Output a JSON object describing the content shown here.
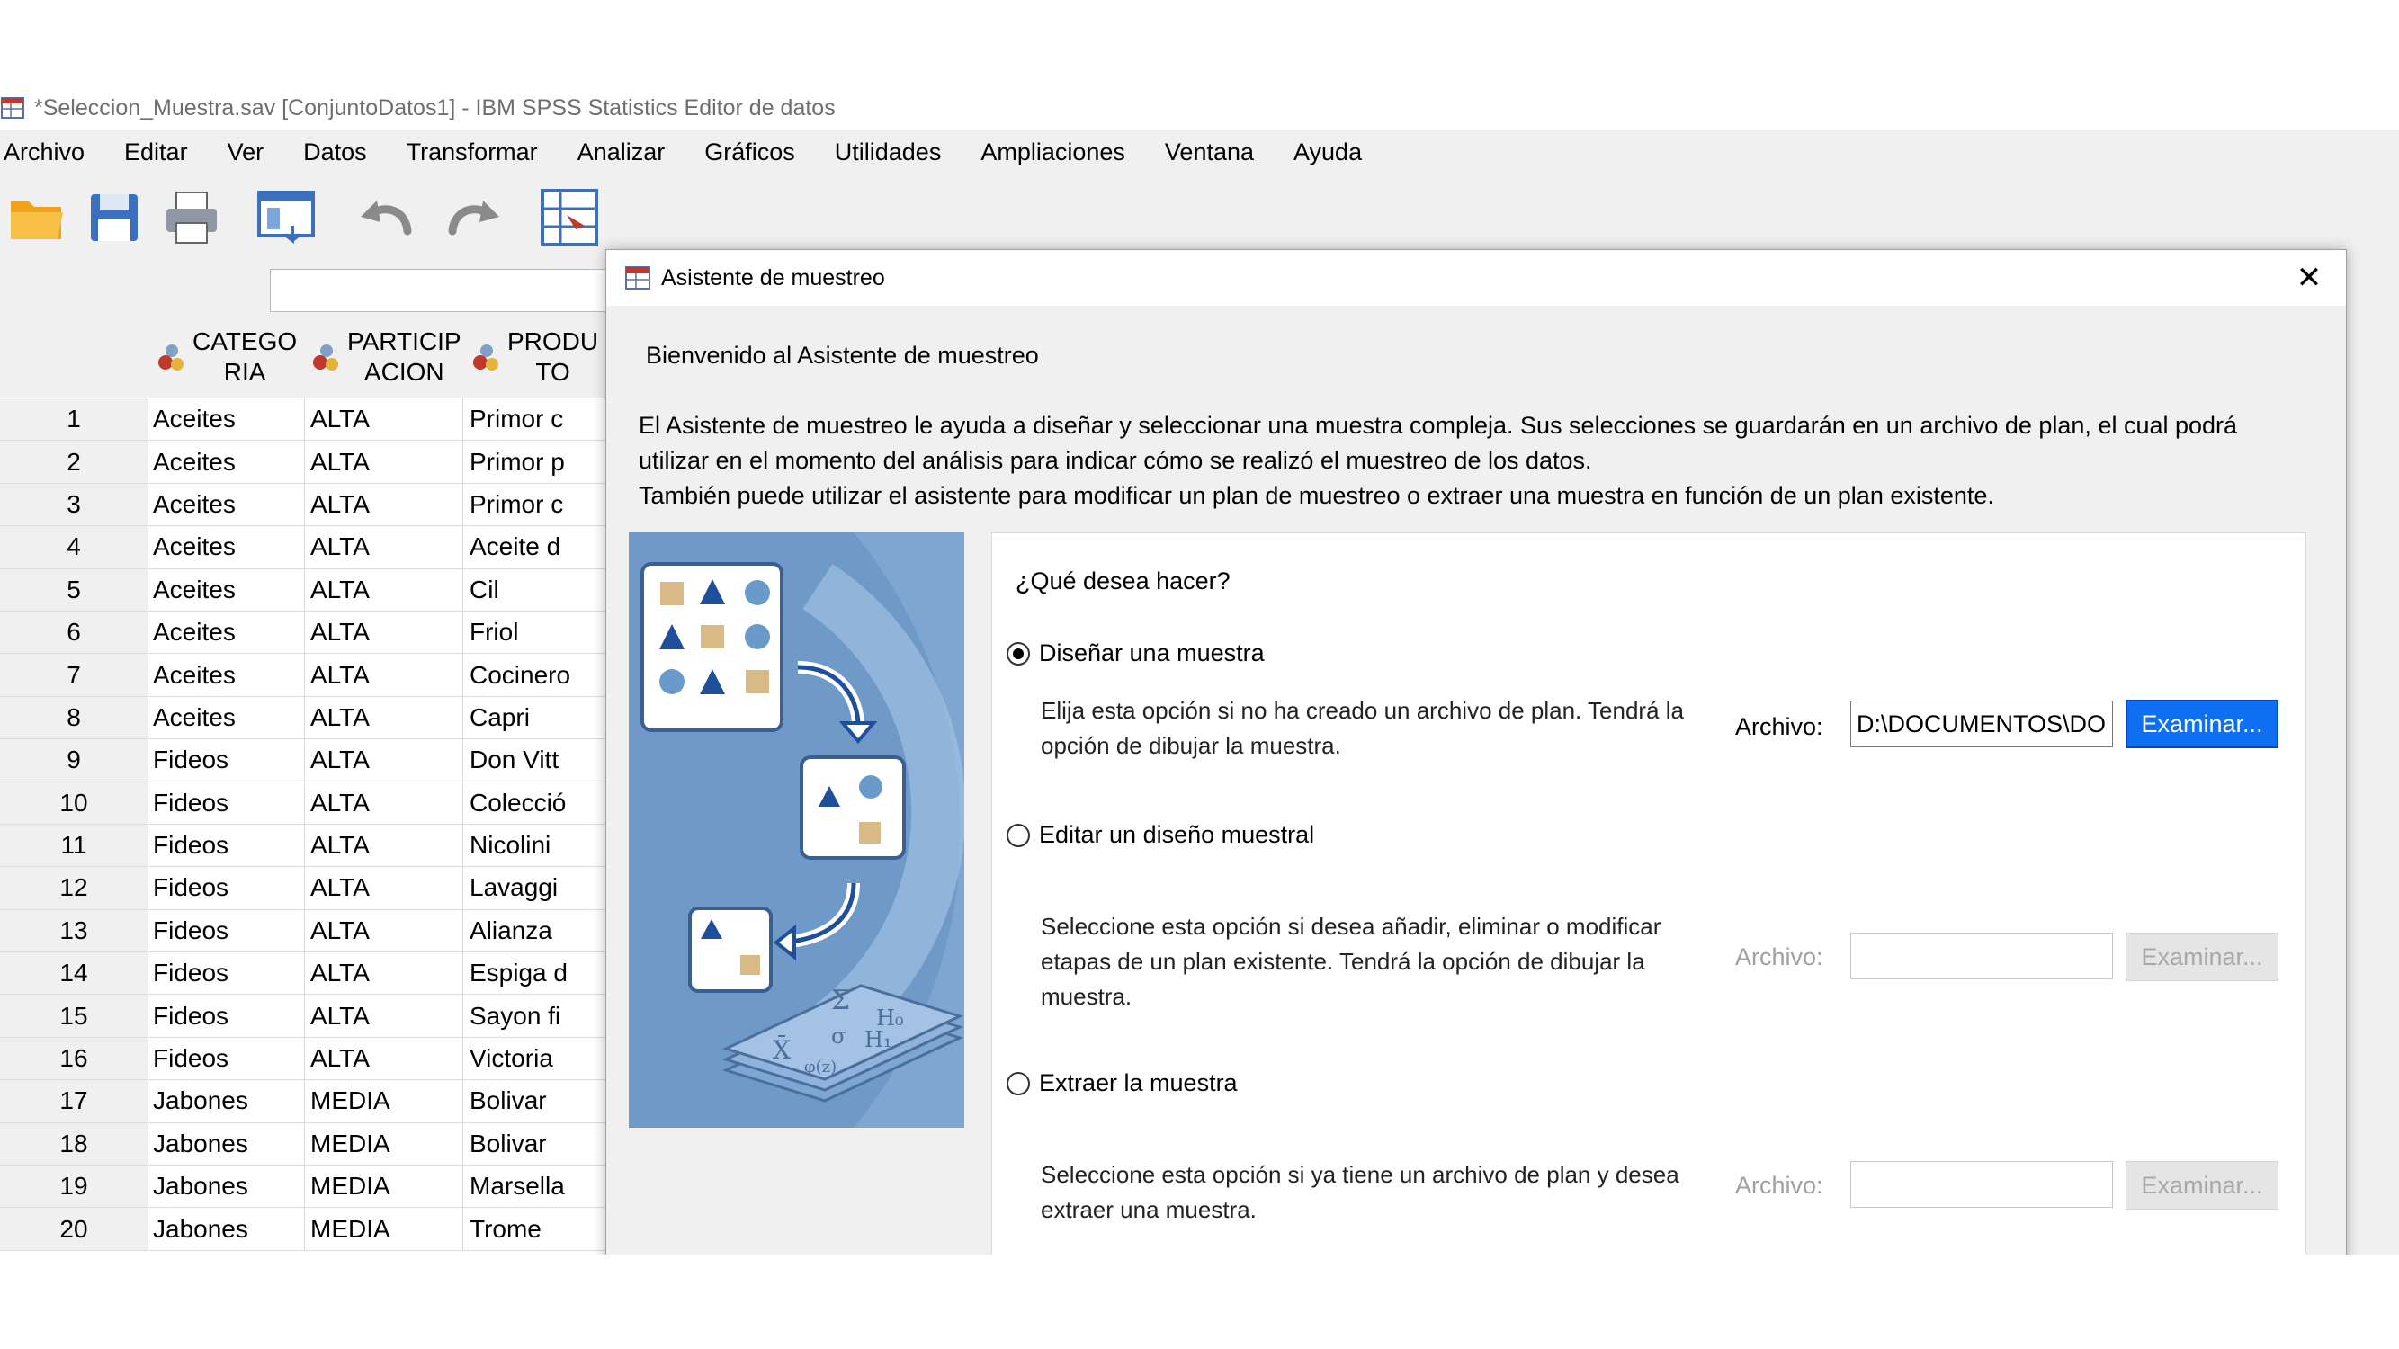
{
  "window": {
    "title": "*Seleccion_Muestra.sav [ConjuntoDatos1] - IBM SPSS Statistics Editor de datos",
    "menu": [
      "Archivo",
      "Editar",
      "Ver",
      "Datos",
      "Transformar",
      "Analizar",
      "Gráficos",
      "Utilidades",
      "Ampliaciones",
      "Ventana",
      "Ayuda"
    ]
  },
  "toolbar_icons": [
    "open-folder-icon",
    "save-icon",
    "print-icon",
    "recall-dialog-icon",
    "undo-icon",
    "redo-icon",
    "goto-case-icon"
  ],
  "grid": {
    "columns": [
      {
        "name": "CATEGO\nRIA"
      },
      {
        "name": "PARTICIP\nACION"
      },
      {
        "name": "PRODU\nTO"
      }
    ],
    "rows": [
      {
        "n": "1",
        "cat": "Aceites",
        "par": "ALTA",
        "pro": "Primor c"
      },
      {
        "n": "2",
        "cat": "Aceites",
        "par": "ALTA",
        "pro": "Primor p"
      },
      {
        "n": "3",
        "cat": "Aceites",
        "par": "ALTA",
        "pro": "Primor c"
      },
      {
        "n": "4",
        "cat": "Aceites",
        "par": "ALTA",
        "pro": "Aceite d"
      },
      {
        "n": "5",
        "cat": "Aceites",
        "par": "ALTA",
        "pro": "Cil"
      },
      {
        "n": "6",
        "cat": "Aceites",
        "par": "ALTA",
        "pro": "Friol"
      },
      {
        "n": "7",
        "cat": "Aceites",
        "par": "ALTA",
        "pro": "Cocinero"
      },
      {
        "n": "8",
        "cat": "Aceites",
        "par": "ALTA",
        "pro": "Capri"
      },
      {
        "n": "9",
        "cat": "Fideos",
        "par": "ALTA",
        "pro": "Don Vitt"
      },
      {
        "n": "10",
        "cat": "Fideos",
        "par": "ALTA",
        "pro": "Colecció"
      },
      {
        "n": "11",
        "cat": "Fideos",
        "par": "ALTA",
        "pro": "Nicolini"
      },
      {
        "n": "12",
        "cat": "Fideos",
        "par": "ALTA",
        "pro": "Lavaggi"
      },
      {
        "n": "13",
        "cat": "Fideos",
        "par": "ALTA",
        "pro": "Alianza"
      },
      {
        "n": "14",
        "cat": "Fideos",
        "par": "ALTA",
        "pro": "Espiga d"
      },
      {
        "n": "15",
        "cat": "Fideos",
        "par": "ALTA",
        "pro": "Sayon fi"
      },
      {
        "n": "16",
        "cat": "Fideos",
        "par": "ALTA",
        "pro": "Victoria"
      },
      {
        "n": "17",
        "cat": "Jabones",
        "par": "MEDIA",
        "pro": "Bolivar"
      },
      {
        "n": "18",
        "cat": "Jabones",
        "par": "MEDIA",
        "pro": "Bolivar"
      },
      {
        "n": "19",
        "cat": "Jabones",
        "par": "MEDIA",
        "pro": "Marsella"
      },
      {
        "n": "20",
        "cat": "Jabones",
        "par": "MEDIA",
        "pro": "Trome"
      }
    ]
  },
  "dialog": {
    "title": "Asistente de muestreo",
    "close": "✕",
    "welcome": "Bienvenido al Asistente de muestreo",
    "intro_line1": "El Asistente de muestreo le ayuda a diseñar y seleccionar una muestra compleja. Sus selecciones se guardarán en un archivo de plan, el cual podrá",
    "intro_line2": "utilizar en el momento del análisis para indicar cómo se realizó el muestreo de los datos.",
    "intro_line3": "También puede utilizar el asistente para modificar un plan de muestreo o extraer una muestra en función de un plan existente.",
    "question": "¿Qué desea hacer?",
    "options": [
      {
        "label": "Diseñar una muestra",
        "selected": true,
        "description": "Elija esta opción si no ha creado un archivo de plan. Tendrá la opción de dibujar la muestra.",
        "file_label": "Archivo:",
        "file_value": "D:\\DOCUMENTOS\\DO",
        "browse": "Examinar...",
        "enabled": true
      },
      {
        "label": "Editar un diseño muestral",
        "selected": false,
        "description": "Seleccione esta opción si desea añadir, eliminar o modificar etapas de un plan existente. Tendrá la opción de dibujar la muestra.",
        "file_label": "Archivo:",
        "file_value": "",
        "browse": "Examinar...",
        "enabled": false
      },
      {
        "label": "Extraer la muestra",
        "selected": false,
        "description": "Seleccione esta opción si ya tiene un archivo de plan y desea extraer una muestra.",
        "file_label": "Archivo:",
        "file_value": "",
        "browse": "Examinar...",
        "enabled": false
      }
    ],
    "illustration_text": [
      "Σ",
      "H₀",
      "X̄",
      "σ",
      "H₁",
      "φ(z)"
    ]
  },
  "colors": {
    "accent_button": "#0f6ff2",
    "illustration_bg": "#6f9ac7",
    "dialog_bg": "#f0f0f0"
  }
}
